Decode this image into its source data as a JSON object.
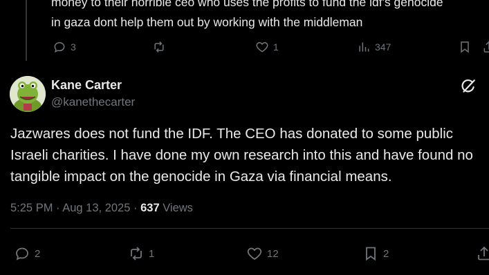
{
  "parent_tweet": {
    "text_line1": "money to their horrible ceo who uses the profits to fund the idf's genocide",
    "text_line2": "in gaza dont help them out by working with the middleman",
    "replies": "3",
    "reposts": "",
    "likes": "1",
    "views": "347"
  },
  "tweet": {
    "author_name": "Kane Carter",
    "author_handle": "@kanethecarter",
    "text": "Jazwares does not fund the IDF. The CEO has donated to some public Israeli charities. I have done my own research into this and have found no tangible impact on the genocide in Gaza via financial means.",
    "time": "5:25 PM",
    "date": "Aug 13, 2025",
    "separator": "·",
    "views_count": "637",
    "views_label": "Views",
    "replies": "2",
    "reposts": "1",
    "likes": "12",
    "bookmarks": "2"
  },
  "colors": {
    "background": "#000000",
    "text_primary": "#e7e9ea",
    "text_secondary": "#71767b",
    "divider": "#2f3336"
  },
  "icons": {
    "reply": "reply-icon",
    "repost": "repost-icon",
    "like": "heart-icon",
    "views": "views-chart-icon",
    "bookmark": "bookmark-icon",
    "share": "share-icon",
    "grok": "grok-icon"
  }
}
